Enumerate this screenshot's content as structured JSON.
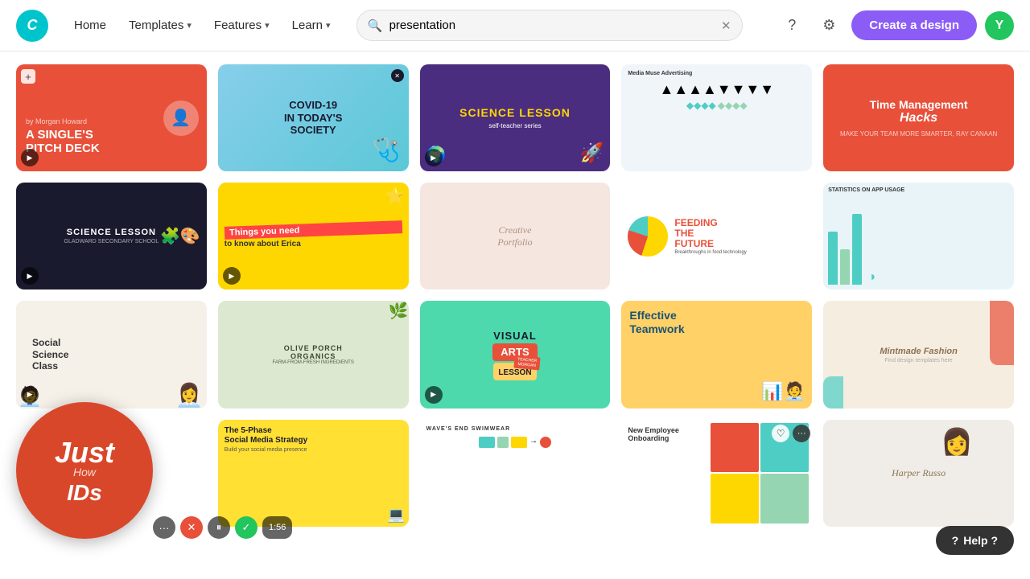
{
  "topbar": {
    "logo_text": "C",
    "nav": [
      {
        "label": "Home",
        "has_arrow": false
      },
      {
        "label": "Templates",
        "has_arrow": true
      },
      {
        "label": "Features",
        "has_arrow": true
      },
      {
        "label": "Learn",
        "has_arrow": true
      }
    ],
    "search_value": "presentation",
    "search_placeholder": "Search",
    "create_label": "Create a design",
    "avatar_letter": "Y",
    "help_label": "Help ?"
  },
  "cards": [
    {
      "id": "singles-pitch-deck",
      "title": "A SINGLE'S PITCH DECK",
      "subtitle": "by Morgan Howard",
      "style": "singles"
    },
    {
      "id": "covid-today",
      "title": "COVID-19 IN TODAY'S SOCIETY",
      "style": "covid"
    },
    {
      "id": "science-lesson-1",
      "title": "SCIENCE LESSON",
      "subtitle": "self-teacher series",
      "style": "science1"
    },
    {
      "id": "media-muse",
      "title": "Media Muse Advertising",
      "style": "media-muse"
    },
    {
      "id": "time-management",
      "title": "Time Management Hacks",
      "style": "time-mgmt"
    },
    {
      "id": "science-lesson-2",
      "title": "SCIENCE LESSON",
      "subtitle": "GLADWARD SECONDARY SCHOOL",
      "style": "science2"
    },
    {
      "id": "things-erica",
      "title": "Things you need to know about Erica",
      "style": "things"
    },
    {
      "id": "creative-portfolio",
      "title": "Creative Portfolio",
      "style": "creative"
    },
    {
      "id": "feeding-future",
      "title": "FEEDING THE FUTURE",
      "subtitle": "Breakthroughs in food technology",
      "style": "feeding"
    },
    {
      "id": "stats-app",
      "title": "STATISTICS ON APP USAGE",
      "style": "stats"
    },
    {
      "id": "social-science",
      "title": "Social Science Class",
      "style": "social-sci"
    },
    {
      "id": "olive-porch",
      "title": "OLIVE PORCH ORGANICS",
      "subtitle": "FARM-FROM-FRESH INGREDIENTS",
      "style": "olive"
    },
    {
      "id": "visual-arts",
      "title": "VISUAL ARTS LESSON",
      "style": "visual"
    },
    {
      "id": "effective-teamwork",
      "title": "Effective Teamwork",
      "style": "effective"
    },
    {
      "id": "mintmade-fashion",
      "title": "Mintmade Fashion",
      "style": "mintmade"
    },
    {
      "id": "just-ids",
      "title": "Just IDs",
      "style": "just-ids"
    },
    {
      "id": "5phase-social",
      "title": "The 5-Phase Social Media Strategy",
      "subtitle": "Build your social media presence",
      "style": "5phase"
    },
    {
      "id": "waves-swimwear",
      "title": "WAVE'S END SWIMWEAR",
      "style": "waves"
    },
    {
      "id": "new-employee",
      "title": "New Employee Onboarding",
      "style": "new-emp"
    },
    {
      "id": "harper-russo",
      "title": "Harper Russo",
      "style": "harper"
    }
  ],
  "floating_circle": {
    "line1": "Just",
    "line2": "IDs"
  },
  "video_controls": {
    "time": "1:56"
  }
}
